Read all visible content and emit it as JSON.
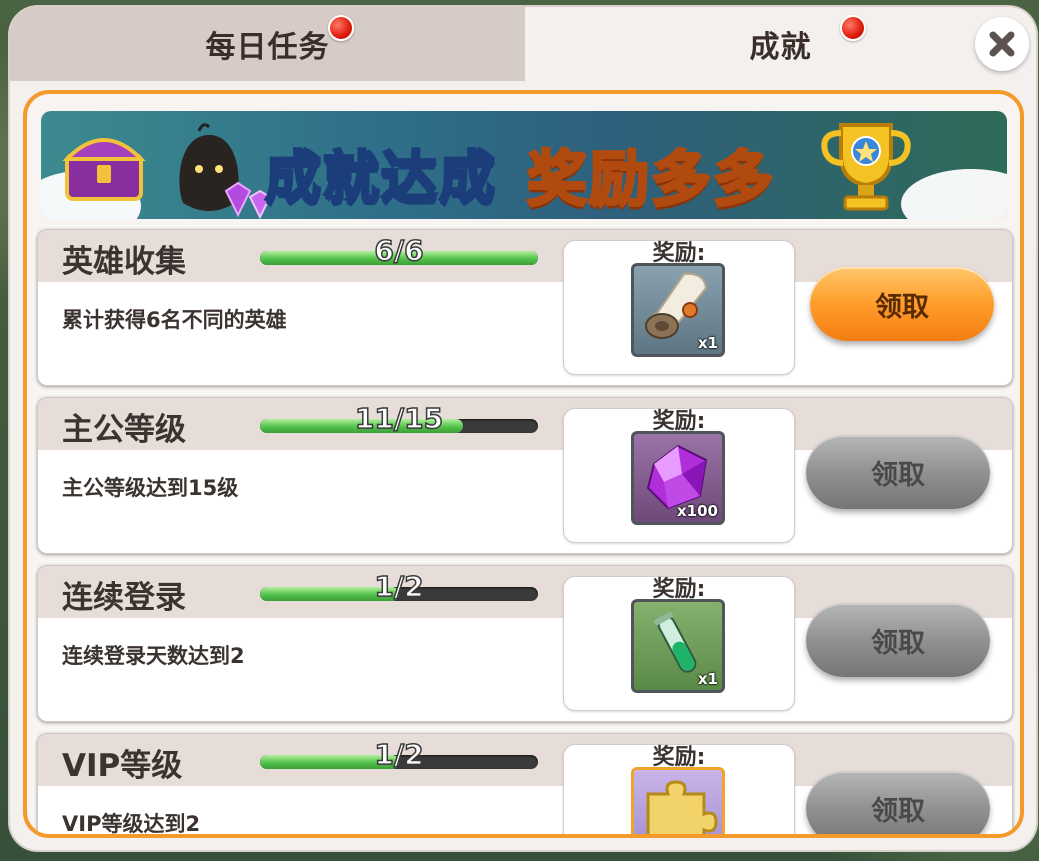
{
  "tabs": [
    {
      "label": "每日任务",
      "active": false,
      "has_notification": true
    },
    {
      "label": "成就",
      "active": true,
      "has_notification": true
    }
  ],
  "banner": {
    "title_part1": "成就达成",
    "title_part2": "奖励多多"
  },
  "reward_label": "奖励:",
  "achievements": [
    {
      "title": "英雄收集",
      "description": "累计获得6名不同的英雄",
      "progress_text": "6/6",
      "progress": 1.0,
      "reward_icon": "scroll-icon",
      "reward_qty": "x1",
      "button_label": "领取",
      "button_state": "active"
    },
    {
      "title": "主公等级",
      "description": "主公等级达到15级",
      "progress_text": "11/15",
      "progress": 0.73,
      "reward_icon": "purple-gem-icon",
      "reward_qty": "x100",
      "button_label": "领取",
      "button_state": "disabled"
    },
    {
      "title": "连续登录",
      "description": "连续登录天数达到2",
      "progress_text": "1/2",
      "progress": 0.5,
      "reward_icon": "green-potion-icon",
      "reward_qty": "x1",
      "button_label": "领取",
      "button_state": "disabled"
    },
    {
      "title": "VIP等级",
      "description": "VIP等级达到2",
      "progress_text": "1/2",
      "progress": 0.5,
      "reward_icon": "puzzle-piece-icon",
      "reward_qty": "",
      "button_label": "领取",
      "button_state": "disabled"
    }
  ],
  "colors": {
    "accent_orange": "#f39a2a",
    "progress_green": "#52c24a",
    "notification_red": "#e01a0a"
  }
}
